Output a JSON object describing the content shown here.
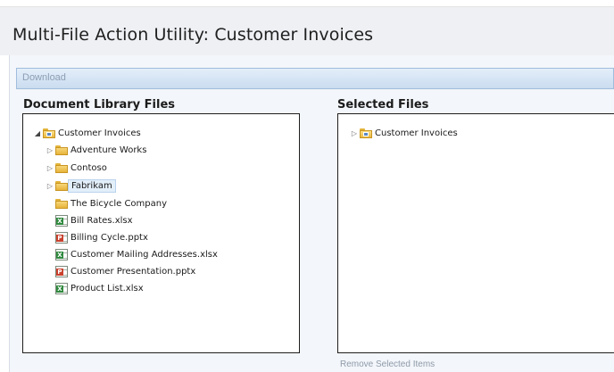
{
  "page": {
    "title": "Multi-File Action Utility: Customer Invoices"
  },
  "ribbon": {
    "download_label": "Download"
  },
  "left_panel": {
    "heading": "Document Library Files",
    "root": "Customer Invoices",
    "items": [
      {
        "label": "Adventure Works",
        "type": "folder"
      },
      {
        "label": "Contoso",
        "type": "folder"
      },
      {
        "label": "Fabrikam",
        "type": "folder"
      },
      {
        "label": "The Bicycle Company",
        "type": "folder"
      },
      {
        "label": "Bill Rates.xlsx",
        "type": "xlsx"
      },
      {
        "label": "Billing Cycle.pptx",
        "type": "pptx"
      },
      {
        "label": "Customer Mailing Addresses.xlsx",
        "type": "xlsx"
      },
      {
        "label": "Customer Presentation.pptx",
        "type": "pptx"
      },
      {
        "label": "Product List.xlsx",
        "type": "xlsx"
      }
    ]
  },
  "right_panel": {
    "heading": "Selected Files",
    "root": "Customer Invoices",
    "remove_label": "Remove Selected Items"
  }
}
